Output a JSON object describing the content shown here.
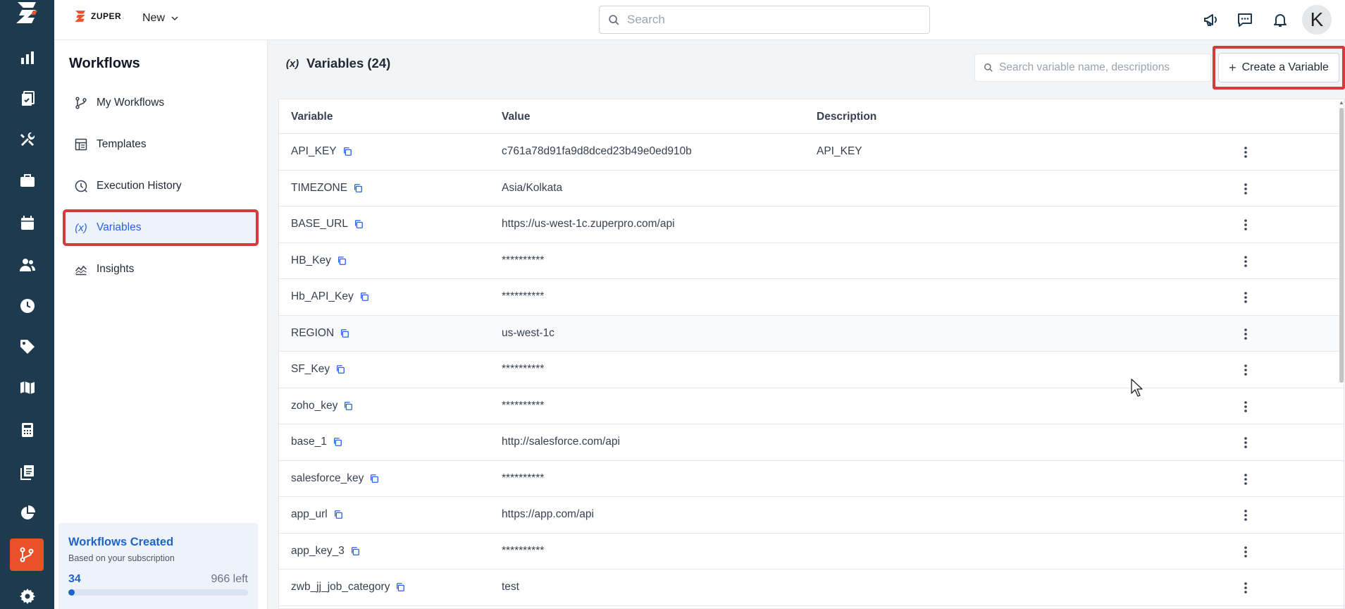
{
  "topbar": {
    "brand_name": "ZUPER",
    "new_label": "New",
    "search_placeholder": "Search",
    "avatar_initial": "K"
  },
  "rail": {
    "icons": [
      "zuper-logo-icon",
      "dashboard-icon",
      "jobs-icon",
      "tools-icon",
      "briefcase-icon",
      "calendar-icon",
      "users-icon",
      "clock-icon",
      "tag-icon",
      "map-icon",
      "calculator-icon",
      "documents-icon",
      "reports-icon",
      "workflow-icon",
      "settings-icon"
    ],
    "active": "workflow-icon",
    "accent_color": "#e8512a",
    "background": "#1e3a4f"
  },
  "sidebar": {
    "title": "Workflows",
    "items": [
      {
        "label": "My Workflows",
        "icon": "workflow-branch-icon"
      },
      {
        "label": "Templates",
        "icon": "template-icon"
      },
      {
        "label": "Execution History",
        "icon": "history-icon"
      },
      {
        "label": "Variables",
        "icon": "variable-icon"
      },
      {
        "label": "Insights",
        "icon": "insights-icon"
      }
    ],
    "active_item": "Variables",
    "usage": {
      "title": "Workflows Created",
      "subtitle": "Based on your subscription",
      "count": "34",
      "remaining": "966 left",
      "progress": 0.034
    }
  },
  "main": {
    "title": "Variables (24)",
    "search_placeholder": "Search variable name, descriptions",
    "create_label": "Create a Variable",
    "columns": [
      "Variable",
      "Value",
      "Description"
    ],
    "rows": [
      {
        "name": "API_KEY",
        "value": "c761a78d91fa9d8dced23b49e0ed910b",
        "description": "API_KEY"
      },
      {
        "name": "TIMEZONE",
        "value": "Asia/Kolkata",
        "description": ""
      },
      {
        "name": "BASE_URL",
        "value": "https://us-west-1c.zuperpro.com/api",
        "description": ""
      },
      {
        "name": "HB_Key",
        "value": "**********",
        "description": ""
      },
      {
        "name": "Hb_API_Key",
        "value": "**********",
        "description": ""
      },
      {
        "name": "REGION",
        "value": "us-west-1c",
        "description": ""
      },
      {
        "name": "SF_Key",
        "value": "**********",
        "description": ""
      },
      {
        "name": "zoho_key",
        "value": "**********",
        "description": ""
      },
      {
        "name": "base_1",
        "value": "http://salesforce.com/api",
        "description": ""
      },
      {
        "name": "salesforce_key",
        "value": "**********",
        "description": ""
      },
      {
        "name": "app_url",
        "value": "https://app.com/api",
        "description": ""
      },
      {
        "name": "app_key_3",
        "value": "**********",
        "description": ""
      },
      {
        "name": "zwb_jj_job_category",
        "value": "test",
        "description": ""
      }
    ]
  },
  "colors": {
    "highlight_outline": "#d63b3b",
    "active_blue": "#2563eb",
    "usage_blue": "#1d64c9"
  }
}
